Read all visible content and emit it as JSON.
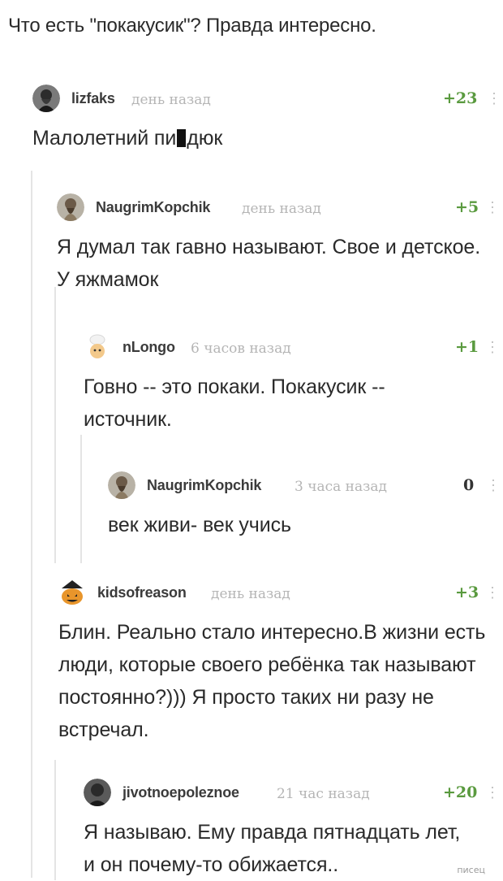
{
  "post": {
    "title": "Что есть \"покакусик\"? Правда интересно."
  },
  "comments": [
    {
      "author": "lizfaks",
      "time": "день назад",
      "rating": "+23",
      "text_before": "Малолетний пи",
      "text_after": "дюк",
      "avatar_icon": "bearded-man-avatar-icon"
    },
    {
      "author": "NaugrimKopchik",
      "time": "день назад",
      "rating": "+5",
      "text": "Я думал так гавно называют. Свое и детское. У яжмамок",
      "avatar_icon": "dwarf-warrior-avatar-icon"
    },
    {
      "author": "nLongo",
      "time": "6 часов назад",
      "rating": "+1",
      "text": "Говно -- это покаки. Покакусик -- источник.",
      "avatar_icon": "cartoon-chef-avatar-icon"
    },
    {
      "author": "NaugrimKopchik",
      "time": "3 часа назад",
      "rating": "0",
      "text": "век живи- век учись",
      "avatar_icon": "dwarf-warrior-avatar-icon"
    },
    {
      "author": "kidsofreason",
      "time": "день назад",
      "rating": "+3",
      "text": "Блин. Реально стало интересно.В жизни есть люди, которые своего ребёнка так называют постоянно?))) Я просто таких ни разу не встречал.",
      "avatar_icon": "jack-o-lantern-avatar-icon"
    },
    {
      "author": "jivotnoepoleznoe",
      "time": "21 час назад",
      "rating": "+20",
      "text": "Я называю. Ему правда пятнадцать лет, и он почему-то обижается..",
      "avatar_icon": "dark-portrait-avatar-icon"
    }
  ],
  "more_icon": "⋮",
  "watermark": "писец",
  "colors": {
    "rating_positive": "#5a9a3f",
    "thread_line": "#e4e4e4",
    "time_text": "#b5b5b5"
  }
}
